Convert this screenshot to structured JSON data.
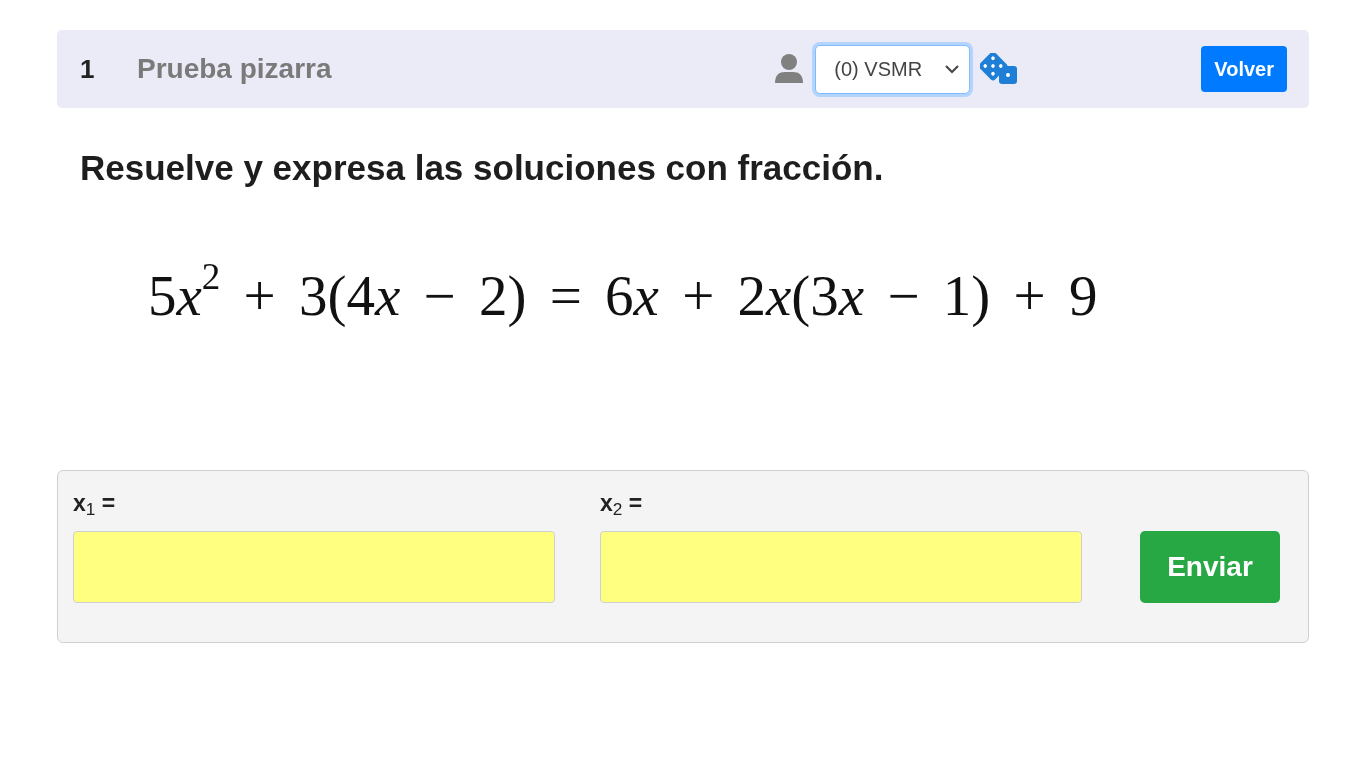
{
  "header": {
    "number": "1",
    "title": "Prueba pizarra",
    "student_select": {
      "value": "(0) VSMR",
      "focused": true
    },
    "back_button": "Volver"
  },
  "instruction": "Resuelve y expresa las soluciones con fracción.",
  "equation": [
    {
      "kind": "text",
      "text": "5"
    },
    {
      "kind": "variable",
      "text": "x"
    },
    {
      "kind": "power",
      "text": "2"
    },
    {
      "kind": "text",
      "text": " + 3(4"
    },
    {
      "kind": "variable",
      "text": "x"
    },
    {
      "kind": "text",
      "text": " − 2) = 6"
    },
    {
      "kind": "variable",
      "text": "x"
    },
    {
      "kind": "text",
      "text": " + 2"
    },
    {
      "kind": "variable",
      "text": "x"
    },
    {
      "kind": "text",
      "text": "(3"
    },
    {
      "kind": "variable",
      "text": "x"
    },
    {
      "kind": "text",
      "text": " − 1) + 9"
    }
  ],
  "answers": [
    {
      "label": "x$_{1}$ ="
    },
    {
      "label": "x$_{2}$ ="
    }
  ],
  "submit_button": "Enviar"
}
